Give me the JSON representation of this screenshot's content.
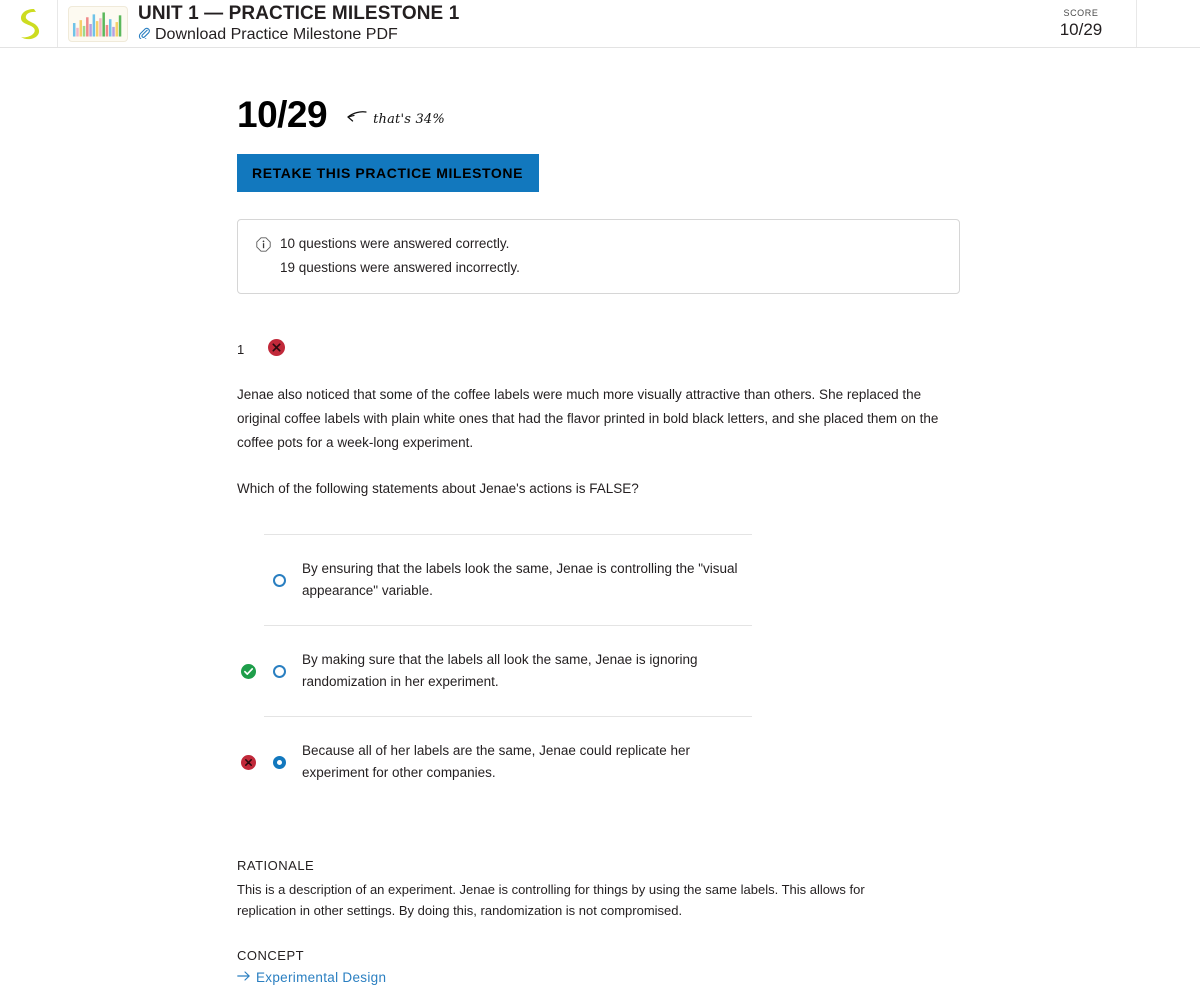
{
  "header": {
    "logo_alt": "sophia-logo",
    "thumbnail_alt": "bar-chart-thumbnail",
    "unit_title": "UNIT 1 — PRACTICE MILESTONE 1",
    "download_label": "Download Practice Milestone PDF",
    "score_label": "SCORE",
    "score_value": "10/29"
  },
  "summary": {
    "big_score": "10/29",
    "annotation": "that's 34%",
    "retake_label": "RETAKE THIS PRACTICE MILESTONE",
    "info_correct": "10 questions were answered correctly.",
    "info_incorrect": "19 questions were answered incorrectly."
  },
  "question": {
    "number": "1",
    "status": "incorrect",
    "passage": "Jenae also noticed that some of the coffee labels were much more visually attractive than others. She replaced the original coffee labels with plain white ones that had the flavor printed in bold black letters, and she placed them on the coffee pots for a week-long experiment.",
    "prompt": "Which of the following statements about Jenae's actions is FALSE?",
    "options": [
      {
        "text": "By ensuring that the labels look the same, Jenae is controlling the \"visual appearance\" variable.",
        "mark": "none",
        "selected": false
      },
      {
        "text": "By making sure that the labels all look the same, Jenae is ignoring randomization in her experiment.",
        "mark": "correct",
        "selected": false
      },
      {
        "text": "Because all of her labels are the same, Jenae could replicate her experiment for other companies.",
        "mark": "incorrect",
        "selected": true
      }
    ]
  },
  "rationale": {
    "label": "RATIONALE",
    "text": "This is a description of an experiment.  Jenae is controlling for things by using the same labels.  This allows for replication in other settings.  By doing this, randomization is not compromised."
  },
  "concept": {
    "label": "CONCEPT",
    "link_text": "Experimental Design"
  },
  "colors": {
    "brand_green": "#cddc20",
    "link_blue": "#2a7fc1",
    "button_blue": "#1278be",
    "correct_green": "#1e9e4a",
    "incorrect_red": "#c1293a"
  }
}
